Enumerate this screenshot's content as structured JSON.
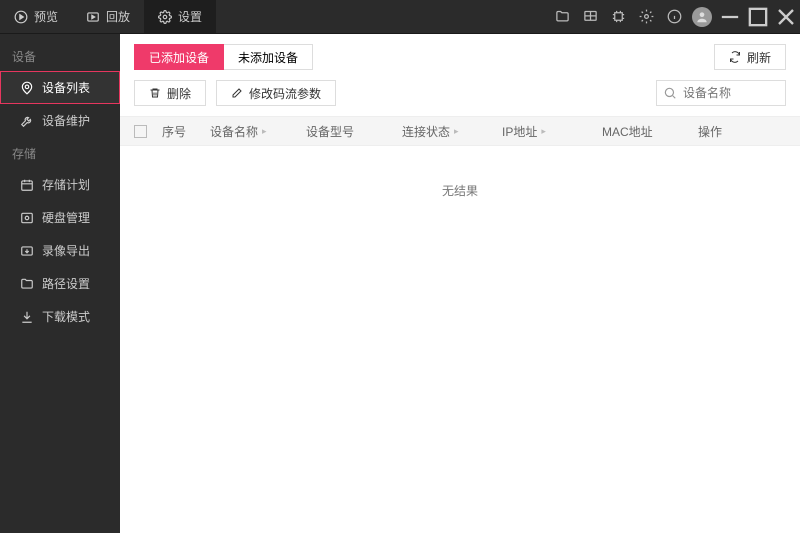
{
  "titlebar": {
    "tabs": [
      {
        "label": "预览"
      },
      {
        "label": "回放"
      },
      {
        "label": "设置"
      }
    ],
    "active_tab": 2
  },
  "sidebar": {
    "groups": [
      {
        "label": "设备",
        "items": [
          {
            "label": "设备列表",
            "icon": "device-pin-icon",
            "active": true
          },
          {
            "label": "设备维护",
            "icon": "wrench-icon"
          }
        ]
      },
      {
        "label": "存储",
        "items": [
          {
            "label": "存储计划",
            "icon": "calendar-icon"
          },
          {
            "label": "硬盘管理",
            "icon": "disk-icon"
          },
          {
            "label": "录像导出",
            "icon": "export-icon"
          },
          {
            "label": "路径设置",
            "icon": "folder-icon"
          },
          {
            "label": "下载模式",
            "icon": "download-icon"
          }
        ]
      }
    ]
  },
  "toolbar": {
    "seg_added": "已添加设备",
    "seg_notadded": "未添加设备",
    "refresh": "刷新",
    "delete": "删除",
    "modify": "修改码流参数"
  },
  "search": {
    "placeholder": "设备名称"
  },
  "table": {
    "columns": {
      "seq": "序号",
      "name": "设备名称",
      "model": "设备型号",
      "conn": "连接状态",
      "ip": "IP地址",
      "mac": "MAC地址",
      "op": "操作"
    },
    "empty": "无结果"
  }
}
